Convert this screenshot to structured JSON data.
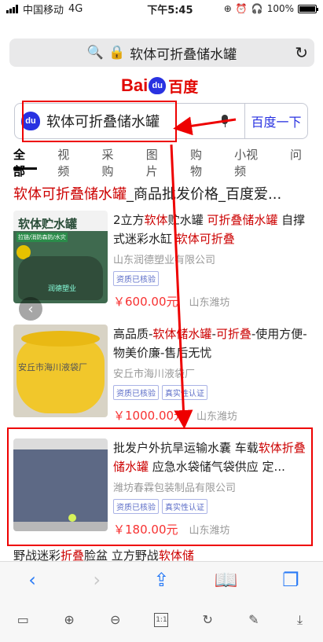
{
  "status": {
    "carrier": "中国移动",
    "network": "4G",
    "time": "下午5:45",
    "battery": "100%",
    "battery_level": 1.0
  },
  "url_bar": {
    "text": "软体可折叠储水罐"
  },
  "logo": {
    "text_a": "Bai",
    "text_paw": "du",
    "text_cn": "百度"
  },
  "search": {
    "value": "软体可折叠储水罐",
    "button": "百度一下",
    "paw": "du"
  },
  "tabs": [
    "全部",
    "视频",
    "采购",
    "图片",
    "购物",
    "小视频",
    "问"
  ],
  "result_title": {
    "em": "软体可折叠储水罐",
    "rest": "_商品批发价格_百度爱..."
  },
  "items": [
    {
      "title_html": [
        "2立方",
        "软体",
        "贮水罐 ",
        "可折叠储水罐",
        " 自撑式迷彩水缸 ",
        "软体可折叠"
      ],
      "shop": "山东润德塑业有限公司",
      "badges": [
        "资质已核验"
      ],
      "price": "￥600.00元",
      "loc": "山东潍坊",
      "thumb_text": "软体贮水罐",
      "thumb_sub": "拉链/消防森防/水灾",
      "thumb_brand": "润德塑业"
    },
    {
      "title_html": [
        "高品质-",
        "软体储水罐",
        "-",
        "可折叠",
        "-使用方便-物美价廉-售后无忧"
      ],
      "shop": "安丘市海川液袋厂",
      "badges": [
        "资质已核验",
        "真实性认证"
      ],
      "price": "￥1000.00元",
      "loc": "山东潍坊",
      "thumb_text": "安丘市海川液袋厂"
    },
    {
      "title_html": [
        "批发户外抗旱运输水囊 车载",
        "软体折叠储水罐",
        " 应急水袋储气袋供应 定..."
      ],
      "shop": "潍坊春霖包装制品有限公司",
      "badges": [
        "资质已核验",
        "真实性认证"
      ],
      "price": "￥180.00元",
      "loc": "山东潍坊"
    }
  ],
  "last_title": {
    "a": "野战迷彩",
    "b": "折叠",
    "c": "脸盆 立方野战",
    "d": "软体储"
  },
  "icons": [
    "back-icon",
    "forward-icon",
    "share-icon",
    "bookmarks-icon",
    "tabs-icon",
    "reader-icon",
    "zoom-in-icon",
    "zoom-out-icon",
    "actual-size-icon",
    "refresh-icon",
    "pen-icon",
    "download-icon"
  ],
  "colors": {
    "accent": "#2932e1",
    "red": "#e10601",
    "annotation": "#e00000",
    "price": "#f73131"
  }
}
